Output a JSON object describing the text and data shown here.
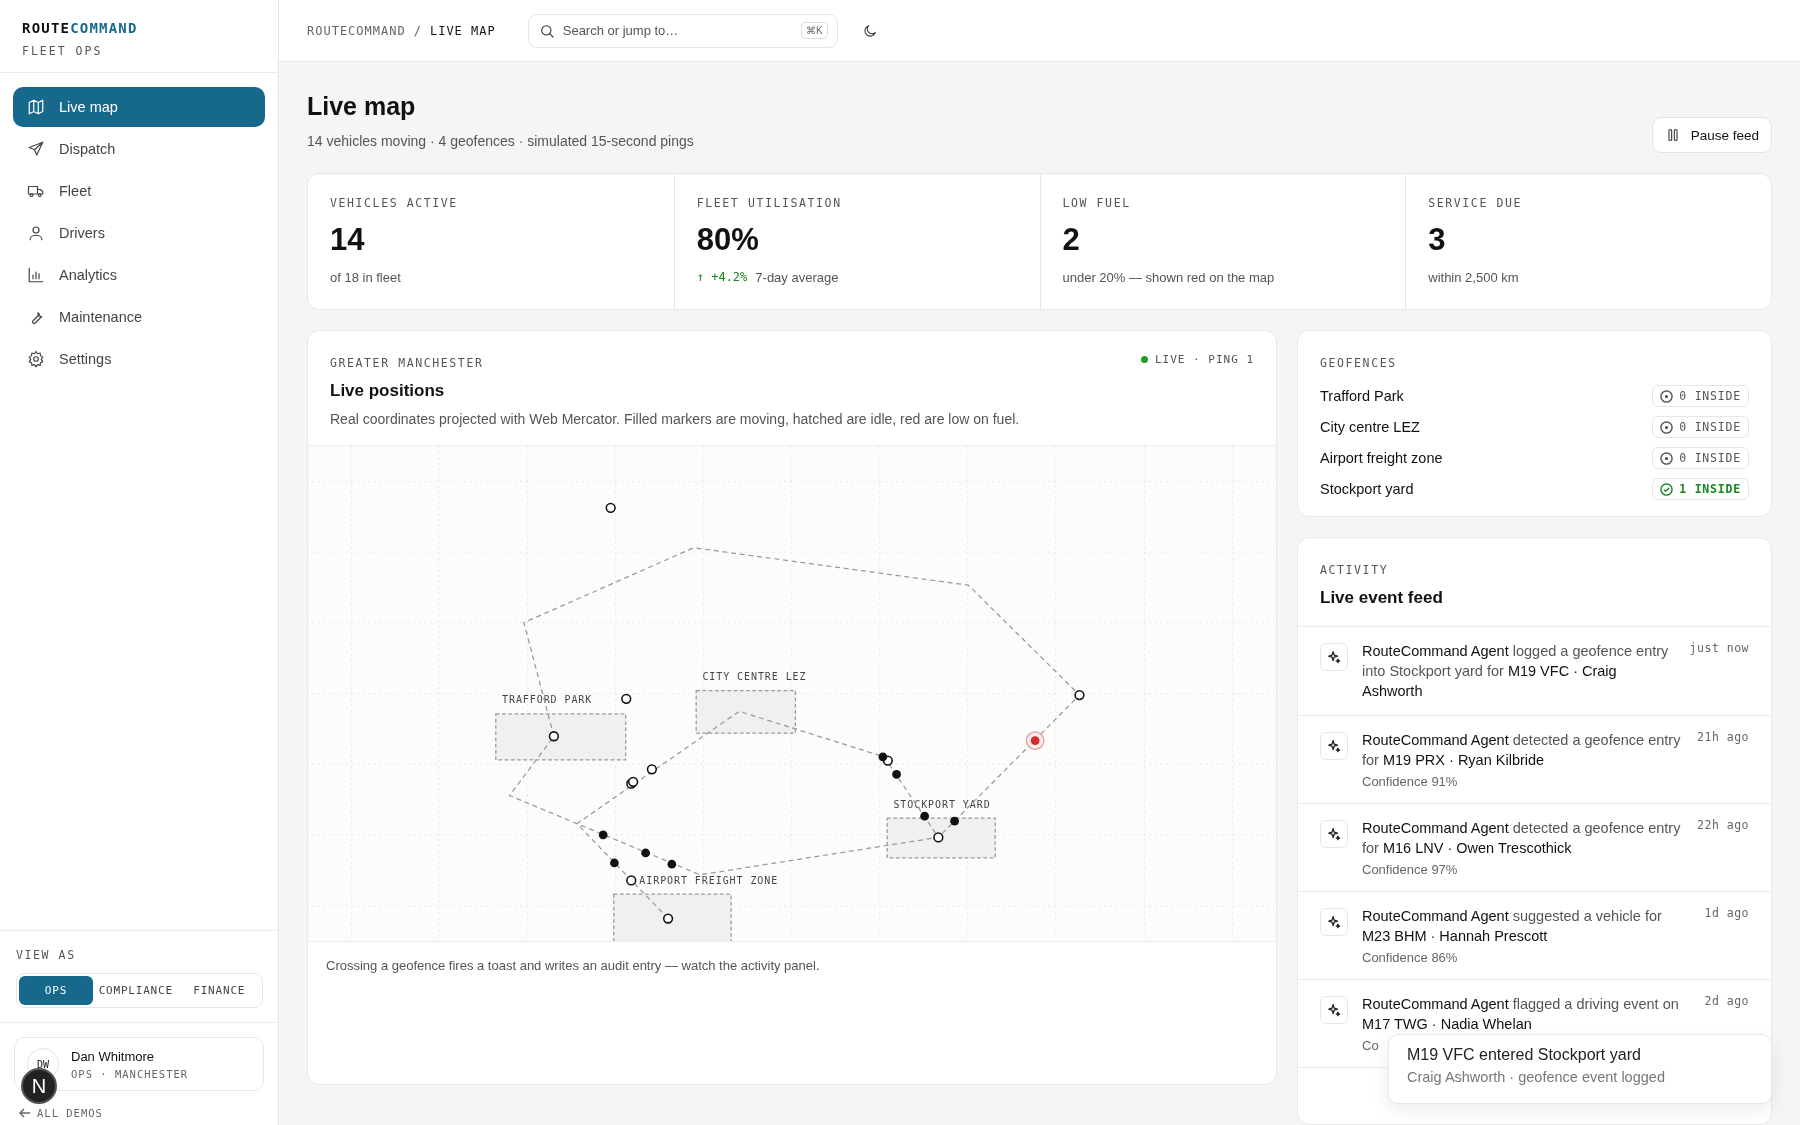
{
  "brand": {
    "name_a": "ROUTE",
    "name_b": "COMMAND",
    "subtitle": "FLEET OPS"
  },
  "nav": [
    {
      "label": "Live map",
      "selected": true
    },
    {
      "label": "Dispatch",
      "selected": false
    },
    {
      "label": "Fleet",
      "selected": false
    },
    {
      "label": "Drivers",
      "selected": false
    },
    {
      "label": "Analytics",
      "selected": false
    },
    {
      "label": "Maintenance",
      "selected": false
    },
    {
      "label": "Settings",
      "selected": false
    }
  ],
  "view_as": {
    "label": "VIEW AS",
    "options": [
      {
        "label": "OPS",
        "selected": true
      },
      {
        "label": "COMPLIANCE",
        "selected": false
      },
      {
        "label": "FINANCE",
        "selected": false
      }
    ]
  },
  "user": {
    "initials": "DW",
    "name": "Dan Whitmore",
    "role": "OPS · MANCHESTER"
  },
  "back_link": "ALL DEMOS",
  "dev_badge": "N",
  "header": {
    "breadcrumb_root": "ROUTECOMMAND",
    "breadcrumb_sep": "/",
    "breadcrumb_current": "LIVE MAP",
    "search": {
      "placeholder": "Search or jump to…",
      "shortcut": "⌘K"
    }
  },
  "page": {
    "title": "Live map",
    "subtitle": "14 vehicles moving · 4 geofences · simulated 15-second pings",
    "pause_button": "Pause feed"
  },
  "stats": [
    {
      "label": "VEHICLES ACTIVE",
      "value": "14",
      "note": "of 18 in fleet"
    },
    {
      "label": "FLEET UTILISATION",
      "value": "80%",
      "delta": "↑ +4.2%",
      "note": "7-day average"
    },
    {
      "label": "LOW FUEL",
      "value": "2",
      "note": "under 20% — shown red on the map"
    },
    {
      "label": "SERVICE DUE",
      "value": "3",
      "note": "within 2,500 km"
    }
  ],
  "map_panel": {
    "eyebrow": "GREATER MANCHESTER",
    "title": "Live positions",
    "description": "Real coordinates projected with Web Mercator. Filled markers are moving, hatched are idle, red are low on fuel.",
    "status": "LIVE · PING 1",
    "live": true,
    "geofences": [
      {
        "label": "TRAFFORD PARK"
      },
      {
        "label": "CITY CENTRE LEZ"
      },
      {
        "label": "STOCKPORT YARD"
      },
      {
        "label": "AIRPORT FREIGHT ZONE"
      }
    ],
    "markers": [
      {
        "kind": "idle"
      },
      {
        "kind": "idle"
      },
      {
        "kind": "idle"
      },
      {
        "kind": "idle"
      },
      {
        "kind": "idle"
      },
      {
        "kind": "idle"
      },
      {
        "kind": "idle"
      },
      {
        "kind": "idle"
      },
      {
        "kind": "idle"
      },
      {
        "kind": "idle"
      },
      {
        "kind": "idle"
      },
      {
        "kind": "moving"
      },
      {
        "kind": "moving"
      },
      {
        "kind": "moving"
      },
      {
        "kind": "moving"
      },
      {
        "kind": "moving"
      },
      {
        "kind": "moving"
      },
      {
        "kind": "moving"
      },
      {
        "kind": "moving"
      },
      {
        "kind": "low_fuel"
      }
    ],
    "footer": "Crossing a geofence fires a toast and writes an audit entry — watch the activity panel."
  },
  "geofences_card": {
    "label": "GEOFENCES",
    "items": [
      {
        "name": "Trafford Park",
        "count": "0 INSIDE",
        "active": false
      },
      {
        "name": "City centre LEZ",
        "count": "0 INSIDE",
        "active": false
      },
      {
        "name": "Airport freight zone",
        "count": "0 INSIDE",
        "active": false
      },
      {
        "name": "Stockport yard",
        "count": "1 INSIDE",
        "active": true
      }
    ]
  },
  "activity": {
    "label": "ACTIVITY",
    "title": "Live event feed",
    "items": [
      {
        "text": "**RouteCommand Agent** logged a geofence entry into Stockport yard for **M19 VFC · Craig Ashworth**",
        "time": "just now"
      },
      {
        "text": "**RouteCommand Agent** detected a geofence entry for **M19 PRX · Ryan Kilbride**",
        "confidence": "Confidence 91%",
        "time": "21h ago"
      },
      {
        "text": "**RouteCommand Agent** detected a geofence entry for **M16 LNV · Owen Trescothick**",
        "confidence": "Confidence 97%",
        "time": "22h ago"
      },
      {
        "text": "**RouteCommand Agent** suggested a vehicle for **M23 BHM · Hannah Prescott**",
        "confidence": "Confidence 86%",
        "time": "1d ago"
      },
      {
        "text": "**RouteCommand Agent** flagged a driving event on **M17 TWG · Nadia Whelan**",
        "confidence": "Co",
        "time": "2d ago"
      }
    ]
  },
  "toast": {
    "title": "M19 VFC entered Stockport yard",
    "body": "Craig Ashworth · geofence event logged"
  }
}
